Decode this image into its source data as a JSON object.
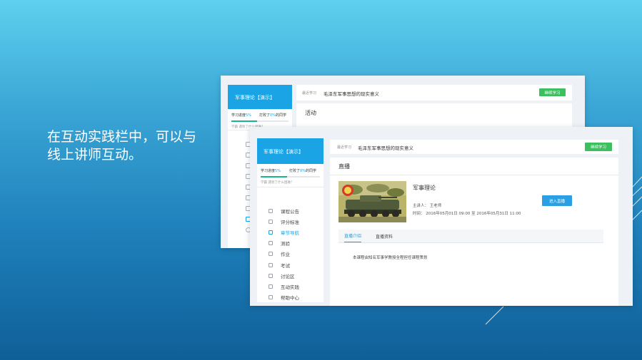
{
  "slide": {
    "headline": "在互动实践栏中，可以与线上讲师互动。"
  },
  "back_window": {
    "course_title": "军事理论【演示】",
    "progress_label": "学习进度",
    "progress_value": "5%",
    "progress_fraction": 0.05,
    "beat_prefix": "打败了",
    "beat_value": "0%",
    "beat_suffix": "的同学",
    "ask_text": "学霸 遇到了什么困难？",
    "recent_label": "最近学习",
    "recent_topic": "毛泽东军事思想的现实意义",
    "continue_label": "继续学习",
    "section_title": "活动"
  },
  "front_window": {
    "course_title": "军事理论【演示】",
    "progress_label": "学习进度",
    "progress_value": "5%",
    "progress_fraction": 0.05,
    "beat_prefix": "打败了",
    "beat_value": "0%",
    "beat_suffix": "的同学",
    "ask_text": "学霸 遇到了什么困难？",
    "menu": [
      {
        "label": "课程公告",
        "icon": "bell-icon"
      },
      {
        "label": "评分标准",
        "icon": "headset-icon"
      },
      {
        "label": "章节导航",
        "icon": "chapter-icon",
        "active": true
      },
      {
        "label": "测验",
        "icon": "quiz-icon"
      },
      {
        "label": "作业",
        "icon": "pencil-icon"
      },
      {
        "label": "考试",
        "icon": "exam-icon"
      },
      {
        "label": "讨论区",
        "icon": "discussion-icon"
      },
      {
        "label": "互动实践",
        "icon": "video-icon"
      },
      {
        "label": "帮助中心",
        "icon": "help-icon"
      }
    ],
    "recent_label": "最近学习",
    "recent_topic": "毛泽东军事思想的现实意义",
    "continue_label": "继续学习",
    "section_title": "直播",
    "live": {
      "name": "军事理论",
      "host_label": "主讲人：",
      "host_name": "王老师",
      "time_label": "时间：",
      "time_start": "2016年05月01日 09:00",
      "time_sep": "至",
      "time_end": "2016年05月31日 11:00",
      "enter_label": "进入直播"
    },
    "tabs": [
      {
        "label": "直播介绍",
        "active": true
      },
      {
        "label": "直播资料",
        "active": false
      }
    ],
    "intro_text": "本课程由知名军事学教授全程担任课程策划"
  },
  "colors": {
    "accent_blue": "#1aa4e6",
    "continue_green": "#3cbf5f",
    "enter_blue": "#2a9fe3"
  }
}
